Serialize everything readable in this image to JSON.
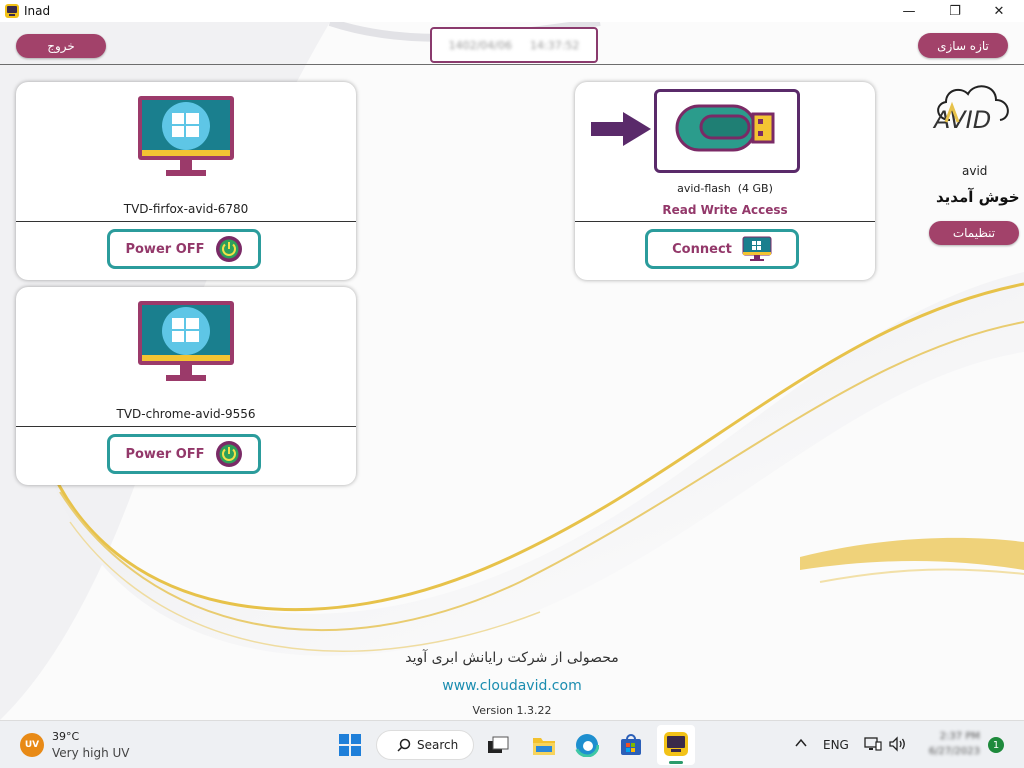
{
  "window": {
    "title": "Inad",
    "minimize": "—",
    "maximize": "❐",
    "close": "✕"
  },
  "toolbar": {
    "exit_label": "خروج",
    "refresh_label": "تازه سازی",
    "date": "1402/04/06",
    "time": "14:37:52"
  },
  "profile": {
    "username": "avid",
    "welcome": "خوش آمدید",
    "settings_label": "تنظیمات",
    "logo_text": "AVID"
  },
  "vms": [
    {
      "name": "TVD-firfox-avid-6780",
      "action_label": "Power OFF"
    },
    {
      "name": "TVD-chrome-avid-9556",
      "action_label": "Power OFF"
    }
  ],
  "usb": {
    "name": "avid-flash",
    "size": "(4 GB)",
    "access": "Read Write Access",
    "action_label": "Connect"
  },
  "footer": {
    "company": "محصولی از شرکت رایانش ابری آوید",
    "website": "www.cloudavid.com",
    "version": "Version 1.3.22"
  },
  "taskbar": {
    "weather_temp": "39°C",
    "weather_desc": "Very high UV",
    "weather_badge": "UV",
    "search_label": "Search",
    "language": "ENG",
    "clock_time": "2:37 PM",
    "clock_date": "6/27/2023",
    "notification_count": "1"
  },
  "colors": {
    "accent": "#a2426a",
    "teal": "#2b9c9c",
    "purple": "#5a2a6a",
    "gold": "#e7c24a",
    "monitor_screen": "#1a7f8e"
  }
}
